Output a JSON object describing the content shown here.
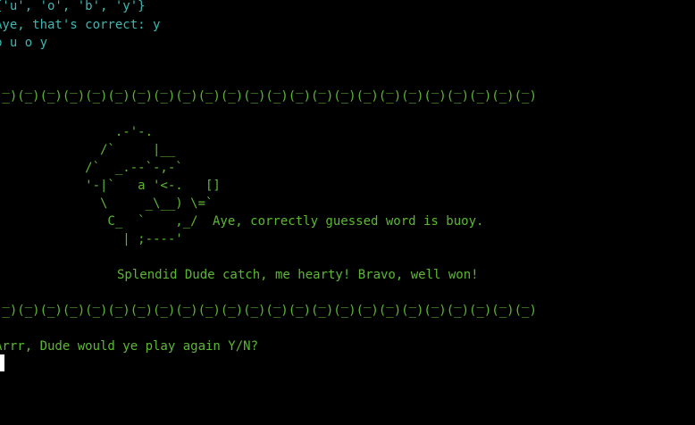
{
  "header_lines": {
    "letters_set": "{'u', 'o', 'b', 'y'}",
    "correct_msg": "Aye, that's correct: y",
    "progress": "b u o y"
  },
  "divider": {
    "top": " _  _  _  _  _  _  _  _  _  _  _  _  _  _  _  _  _  _  _  _  _  _  _  _ ",
    "bottom": "(_)(_)(_)(_)(_)(_)(_)(_)(_)(_)(_)(_)(_)(_)(_)(_)(_)(_)(_)(_)(_)(_)(_)(_)"
  },
  "parrot_art": [
    "                .-'-.",
    "              /`     |__",
    "            /`  _.--`-,-`",
    "            '-|`   a '<-.   []",
    "              \\     _\\__) \\=`",
    "               C_  `    ,_/",
    "                 | ;----'"
  ],
  "win_message": "Aye, correctly guessed word is buoy.",
  "bravo_message": "Splendid Dude catch, me hearty! Bravo, well won!",
  "prompt": "Arrr, Dude would ye play again Y/N?",
  "colors": {
    "background": "#000000",
    "cyan_text": "#3fb7b0",
    "green_text": "#5cb832",
    "cursor": "#ffffff"
  }
}
